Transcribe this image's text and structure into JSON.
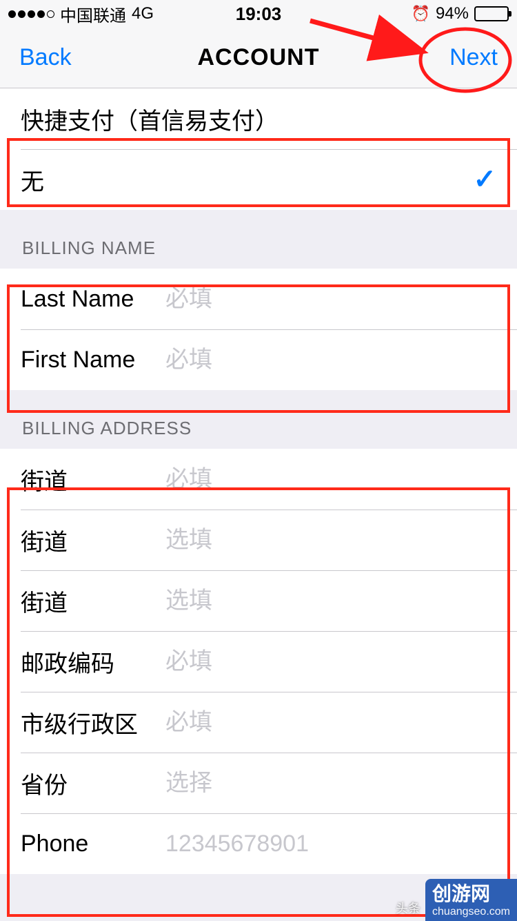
{
  "statusbar": {
    "carrier": "中国联通",
    "network": "4G",
    "time": "19:03",
    "battery_pct": "94%"
  },
  "nav": {
    "back": "Back",
    "title": "ACCOUNT",
    "next": "Next"
  },
  "payment": {
    "option_quickpay": "快捷支付（首信易支付）",
    "option_none": "无"
  },
  "sections": {
    "billing_name": "BILLING NAME",
    "billing_address": "BILLING ADDRESS"
  },
  "billing_name": {
    "last_name_label": "Last Name",
    "last_name_placeholder": "必填",
    "first_name_label": "First Name",
    "first_name_placeholder": "必填"
  },
  "billing_address": {
    "street1_label": "街道",
    "street1_placeholder": "必填",
    "street2_label": "街道",
    "street2_placeholder": "选填",
    "street3_label": "街道",
    "street3_placeholder": "选填",
    "postal_label": "邮政编码",
    "postal_placeholder": "必填",
    "city_label": "市级行政区",
    "city_placeholder": "必填",
    "province_label": "省份",
    "province_placeholder": "选择",
    "phone_label": "Phone",
    "phone_placeholder": "12345678901"
  },
  "watermark": {
    "line1": "创游网",
    "line2": "chuangseo.com",
    "toutiao": "头条"
  },
  "annotation": {
    "arrow_color": "#ff1a1a"
  }
}
